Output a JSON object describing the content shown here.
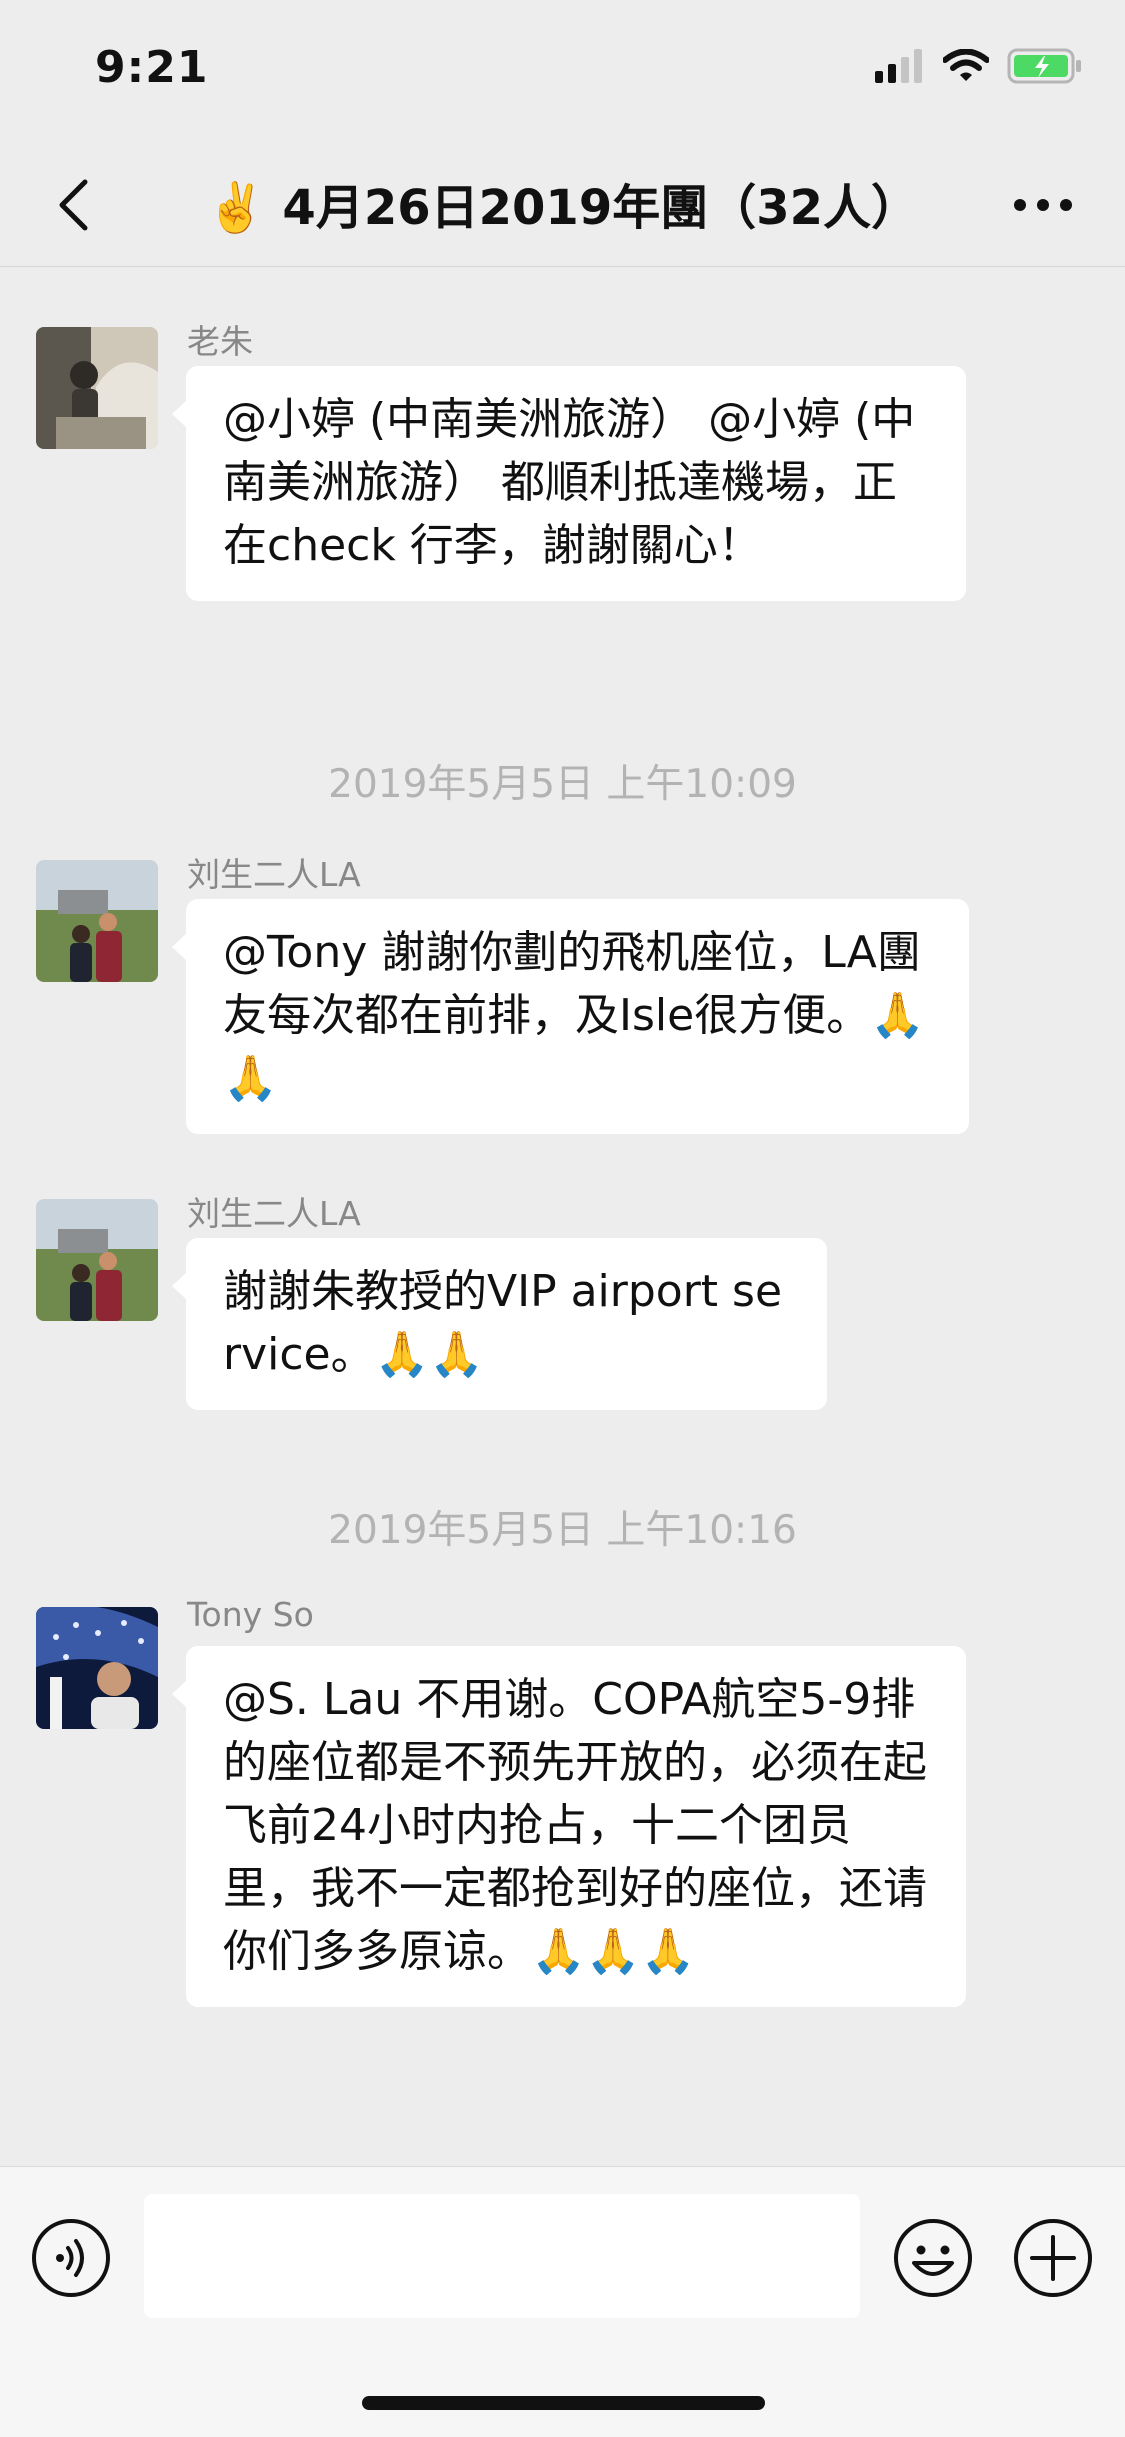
{
  "status_bar": {
    "time": "9:21",
    "icons": [
      "signal-icon",
      "wifi-icon",
      "battery-charging-icon"
    ]
  },
  "nav": {
    "back_icon": "chevron-left-icon",
    "title": "✌️ 4月26日2019年團（32人）",
    "more_icon": "more-dots-icon"
  },
  "messages": [
    {
      "sender": "老朱",
      "text": "@小婷 (中南美洲旅游） @小婷 (中南美洲旅游） 都順利抵達機場，正在check 行李，謝謝關心！"
    },
    {
      "timestamp": "2019年5月5日 上午10:09"
    },
    {
      "sender": "刘生二人LA",
      "text": "@Tony 謝謝你劃的飛机座位，LA團友每次都在前排，及Isle很方便。🙏🙏"
    },
    {
      "sender": "刘生二人LA",
      "text": "謝謝朱教授的VIP airport service。🙏🙏"
    },
    {
      "timestamp": "2019年5月5日 上午10:16"
    },
    {
      "sender": "Tony So",
      "text": "@S. Lau 不用谢。COPA航空5-9排的座位都是不预先开放的，必须在起飞前24小时内抢占，十二个团员里，我不一定都抢到好的座位，还请你们多多原谅。🙏🙏🙏"
    }
  ],
  "input_bar": {
    "voice_icon": "voice-icon",
    "placeholder": "",
    "emoji_icon": "emoji-icon",
    "add_icon": "plus-circle-icon"
  },
  "colors": {
    "background": "#ededed",
    "bubble": "#ffffff",
    "battery": "#4cd964"
  }
}
